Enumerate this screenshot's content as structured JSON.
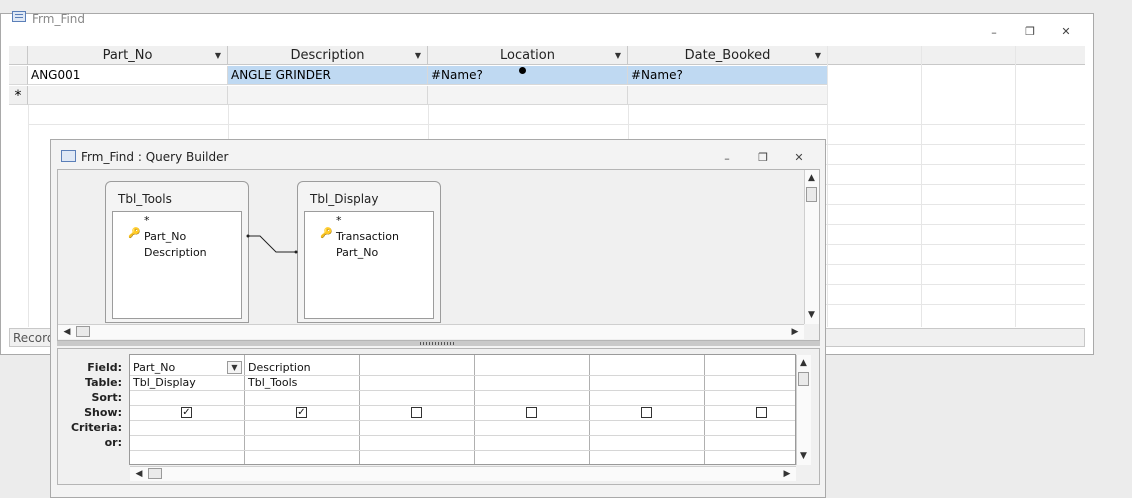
{
  "main_window": {
    "title": "Frm_Find",
    "record_nav_label": "Record",
    "columns": [
      "Part_No",
      "Description",
      "Location",
      "Date_Booked"
    ],
    "rows": [
      [
        "ANG001",
        "ANGLE GRINDER",
        "#Name?",
        "#Name?"
      ]
    ],
    "new_row_marker": "*",
    "controls": {
      "minimize": "–",
      "restore": "❐",
      "close": "✕"
    }
  },
  "query_builder": {
    "title": "Frm_Find : Query Builder",
    "controls": {
      "minimize": "–",
      "restore": "❐",
      "close": "✕"
    },
    "tables": [
      {
        "name": "Tbl_Tools",
        "star": "*",
        "fields": [
          "Part_No",
          "Description"
        ],
        "key_field": "Part_No"
      },
      {
        "name": "Tbl_Display",
        "star": "*",
        "fields": [
          "Transaction",
          "Part_No"
        ],
        "key_field": "Transaction"
      }
    ],
    "grid": {
      "row_labels": [
        "Field:",
        "Table:",
        "Sort:",
        "Show:",
        "Criteria:",
        "or:"
      ],
      "columns": [
        {
          "field": "Part_No",
          "table": "Tbl_Display",
          "show": true
        },
        {
          "field": "Description",
          "table": "Tbl_Tools",
          "show": true
        },
        {
          "field": "",
          "table": "",
          "show": false
        },
        {
          "field": "",
          "table": "",
          "show": false
        },
        {
          "field": "",
          "table": "",
          "show": false
        },
        {
          "field": "",
          "table": "",
          "show": false
        }
      ]
    }
  }
}
